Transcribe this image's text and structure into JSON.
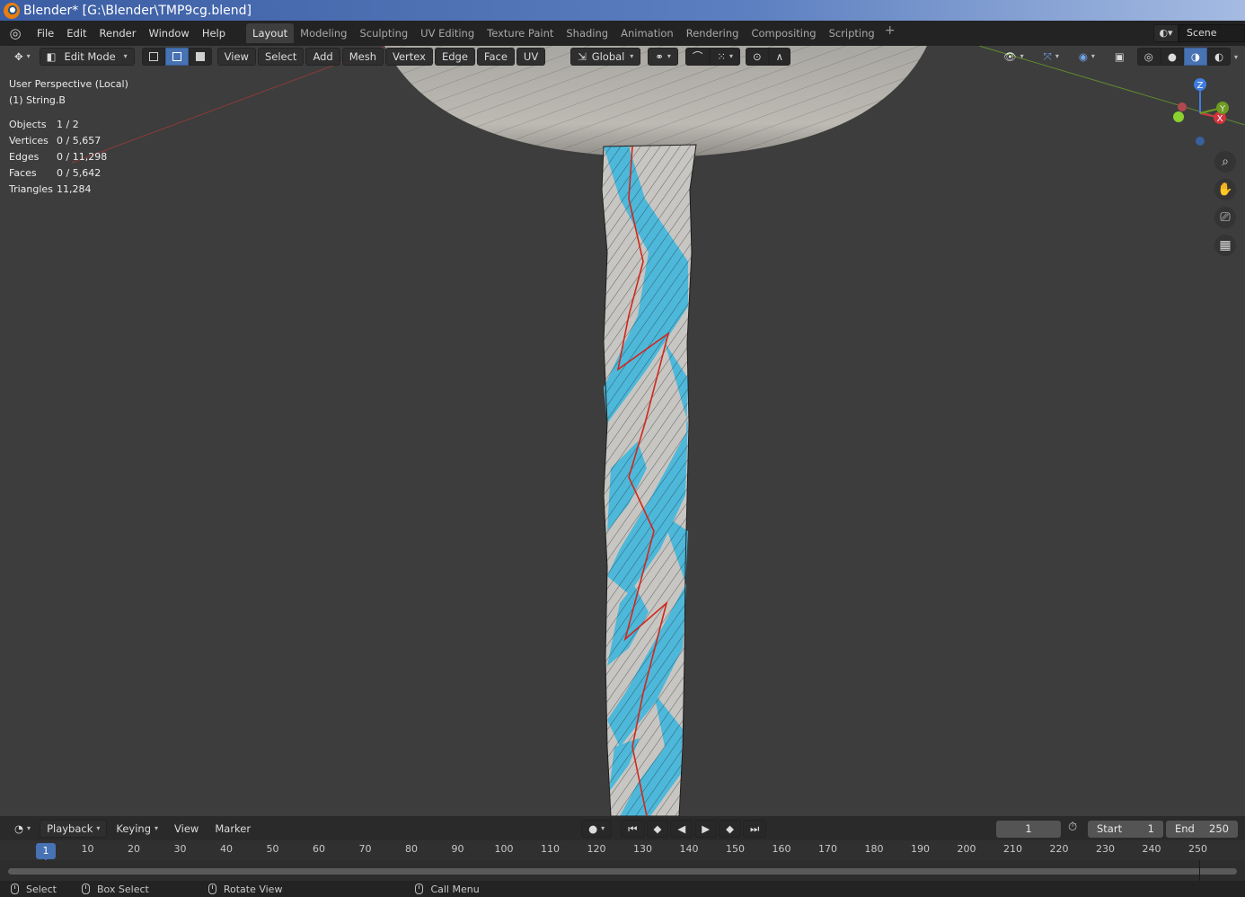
{
  "window": {
    "title": "Blender* [G:\\Blender\\TMP9cg.blend]"
  },
  "menu": [
    "File",
    "Edit",
    "Render",
    "Window",
    "Help"
  ],
  "workspaces": [
    {
      "label": "Layout",
      "active": true
    },
    {
      "label": "Modeling"
    },
    {
      "label": "Sculpting"
    },
    {
      "label": "UV Editing"
    },
    {
      "label": "Texture Paint"
    },
    {
      "label": "Shading"
    },
    {
      "label": "Animation"
    },
    {
      "label": "Rendering"
    },
    {
      "label": "Compositing"
    },
    {
      "label": "Scripting"
    }
  ],
  "scene": {
    "name": "Scene"
  },
  "viewport_header": {
    "mode": "Edit Mode",
    "menus": [
      "View",
      "Select",
      "Add",
      "Mesh",
      "Vertex",
      "Edge",
      "Face",
      "UV"
    ],
    "transform_orientation": "Global"
  },
  "overlay_info": {
    "view": "User Perspective (Local)",
    "object": "(1) String.B",
    "stats": [
      {
        "key": "Objects",
        "value": "1 / 2"
      },
      {
        "key": "Vertices",
        "value": "0 / 5,657"
      },
      {
        "key": "Edges",
        "value": "0 / 11,298"
      },
      {
        "key": "Faces",
        "value": "0 / 5,642"
      },
      {
        "key": "Triangles",
        "value": "11,284"
      }
    ]
  },
  "gizmo": {
    "x": "X",
    "y": "Y",
    "z": "Z"
  },
  "timeline": {
    "menus": [
      "Playback",
      "Keying",
      "View",
      "Marker"
    ],
    "current_frame": "1",
    "start_label": "Start",
    "start": "1",
    "end_label": "End",
    "end": "250",
    "ticks": [
      "1",
      "10",
      "20",
      "30",
      "40",
      "50",
      "60",
      "70",
      "80",
      "90",
      "100",
      "110",
      "120",
      "130",
      "140",
      "150",
      "160",
      "170",
      "180",
      "190",
      "200",
      "210",
      "220",
      "230",
      "240",
      "250"
    ]
  },
  "statusbar": {
    "select": "Select",
    "box_select": "Box Select",
    "rotate_view": "Rotate View",
    "call_menu": "Call Menu"
  },
  "colors": {
    "accent": "#4772b3",
    "mesh_blue": "#4db8da",
    "mesh_grey": "#c8c6c2",
    "seam": "#d0281c"
  }
}
